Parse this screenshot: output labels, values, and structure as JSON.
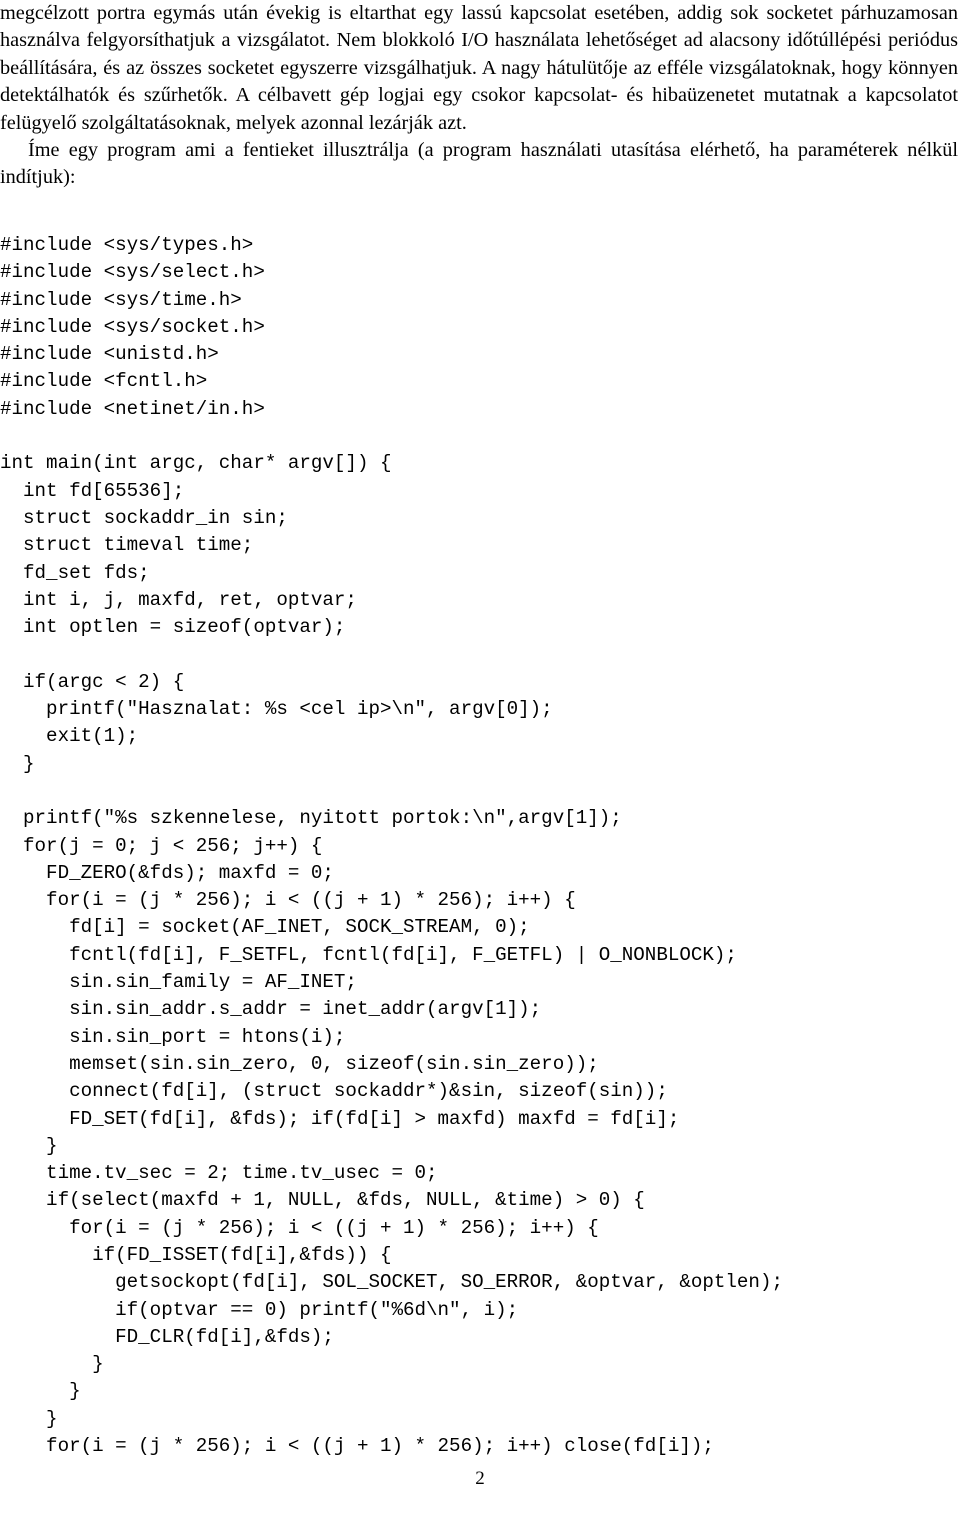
{
  "document": {
    "page_number": "2",
    "paragraphs": [
      {
        "id": "p1",
        "indent": false,
        "text": "megcélzott portra egymás után évekig is eltarthat egy lassú kapcsolat esetében, addig sok socketet párhuzamosan használva felgyorsíthatjuk a vizsgálatot. Nem blokkoló I/O használata lehetőséget ad alacsony időtúllépési periódus beállítására, és az összes socketet egyszerre vizsgálhatjuk. A nagy hátulütője az efféle vizsgálatoknak, hogy könnyen detektálhatók és szűrhetők.  A célbavett gép logjai egy csokor kapcsolat- és hibaüzenetet mutatnak a kapcsolatot felügyelő szolgáltatásoknak, melyek azonnal lezárják azt."
      },
      {
        "id": "p2",
        "indent": true,
        "text": "Íme egy program ami a fentieket illusztrálja (a program használati utasítása elérhető, ha paraméterek nélkül indítjuk):"
      }
    ],
    "code_listing": {
      "language": "c",
      "lines": [
        "#include <sys/types.h>",
        "#include <sys/select.h>",
        "#include <sys/time.h>",
        "#include <sys/socket.h>",
        "#include <unistd.h>",
        "#include <fcntl.h>",
        "#include <netinet/in.h>",
        "",
        "int main(int argc, char* argv[]) {",
        "  int fd[65536];",
        "  struct sockaddr_in sin;",
        "  struct timeval time;",
        "  fd_set fds;",
        "  int i, j, maxfd, ret, optvar;",
        "  int optlen = sizeof(optvar);",
        "",
        "  if(argc < 2) {",
        "    printf(\"Hasznalat: %s <cel ip>\\n\", argv[0]);",
        "    exit(1);",
        "  }",
        "",
        "  printf(\"%s szkennelese, nyitott portok:\\n\",argv[1]);",
        "  for(j = 0; j < 256; j++) {",
        "    FD_ZERO(&fds); maxfd = 0;",
        "    for(i = (j * 256); i < ((j + 1) * 256); i++) {",
        "      fd[i] = socket(AF_INET, SOCK_STREAM, 0);",
        "      fcntl(fd[i], F_SETFL, fcntl(fd[i], F_GETFL) | O_NONBLOCK);",
        "      sin.sin_family = AF_INET;",
        "      sin.sin_addr.s_addr = inet_addr(argv[1]);",
        "      sin.sin_port = htons(i);",
        "      memset(sin.sin_zero, 0, sizeof(sin.sin_zero));",
        "      connect(fd[i], (struct sockaddr*)&sin, sizeof(sin));",
        "      FD_SET(fd[i], &fds); if(fd[i] > maxfd) maxfd = fd[i];",
        "    }",
        "    time.tv_sec = 2; time.tv_usec = 0;",
        "    if(select(maxfd + 1, NULL, &fds, NULL, &time) > 0) {",
        "      for(i = (j * 256); i < ((j + 1) * 256); i++) {",
        "        if(FD_ISSET(fd[i],&fds)) {",
        "          getsockopt(fd[i], SOL_SOCKET, SO_ERROR, &optvar, &optlen);",
        "          if(optvar == 0) printf(\"%6d\\n\", i);",
        "          FD_CLR(fd[i],&fds);",
        "        }",
        "      }",
        "    }",
        "    for(i = (j * 256); i < ((j + 1) * 256); i++) close(fd[i]);"
      ]
    }
  }
}
